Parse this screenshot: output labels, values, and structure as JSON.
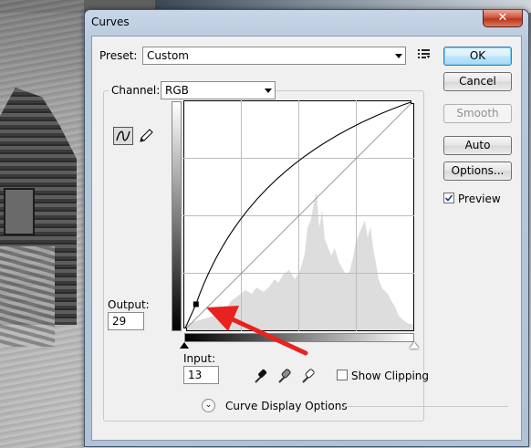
{
  "dialog": {
    "title": "Curves",
    "close_glyph": "✕"
  },
  "preset": {
    "label": "Preset:",
    "value": "Custom",
    "menu_icon": "preset-options-icon"
  },
  "channel": {
    "label": "Channel:",
    "value": "RGB"
  },
  "tools": {
    "curve": "curve-tool-icon",
    "pencil": "pencil-icon"
  },
  "output": {
    "label": "Output:",
    "value": "29"
  },
  "input": {
    "label": "Input:",
    "value": "13"
  },
  "eyedroppers": [
    "black-point-eyedropper-icon",
    "gray-point-eyedropper-icon",
    "white-point-eyedropper-icon"
  ],
  "show_clipping": {
    "label": "Show Clipping",
    "checked": false
  },
  "curve_display_options": {
    "label": "Curve Display Options",
    "toggle_glyph": "⌄"
  },
  "buttons": {
    "ok": "OK",
    "cancel": "Cancel",
    "smooth": "Smooth",
    "auto": "Auto",
    "options": "Options..."
  },
  "preview": {
    "label": "Preview",
    "checked": true
  },
  "curve": {
    "points_io": [
      [
        0,
        0
      ],
      [
        13,
        29
      ],
      [
        255,
        255
      ]
    ],
    "selected_point": [
      13,
      29
    ]
  },
  "annotation": {
    "arrow_color": "#e8231f"
  }
}
